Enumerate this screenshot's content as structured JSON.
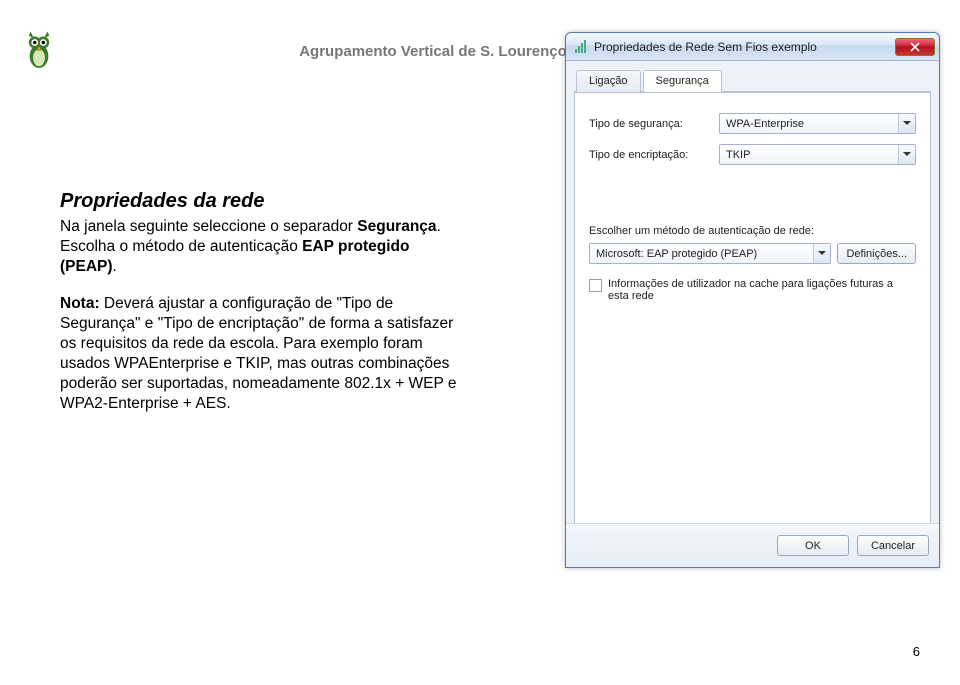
{
  "header": {
    "org_name": "Agrupamento Vertical de S. Lourenço - Ermesinde"
  },
  "article": {
    "title": "Propriedades da rede",
    "p1_before": "Na janela seguinte seleccione o separador ",
    "p1_bold1": "Segurança",
    "p1_mid": ". Escolha o método de autenticação ",
    "p1_bold2": "EAP protegido (PEAP)",
    "p1_after": ".",
    "note_label": "Nota:",
    "note_text": " Deverá ajustar a configuração de \"Tipo de Segurança\" e \"Tipo de encriptação\" de forma a satisfazer os requisitos da rede da escola. Para exemplo foram usados WPAEnterprise e TKIP, mas outras combinações poderão ser suportadas, nomeadamente 802.1x + WEP e WPA2-Enterprise + AES."
  },
  "dialog": {
    "title": "Propriedades de Rede Sem Fios exemplo",
    "close": "X",
    "tabs": {
      "tab1": "Ligação",
      "tab2": "Segurança"
    },
    "sec_type_label": "Tipo de segurança:",
    "sec_type_value": "WPA-Enterprise",
    "enc_type_label": "Tipo de encriptação:",
    "enc_type_value": "TKIP",
    "auth_section": "Escolher um método de autenticação de rede:",
    "auth_value": "Microsoft: EAP protegido (PEAP)",
    "definitions_btn": "Definições...",
    "cache_checkbox": "Informações de utilizador na cache para ligações futuras a esta rede",
    "ok_btn": "OK",
    "cancel_btn": "Cancelar"
  },
  "page_number": "6"
}
